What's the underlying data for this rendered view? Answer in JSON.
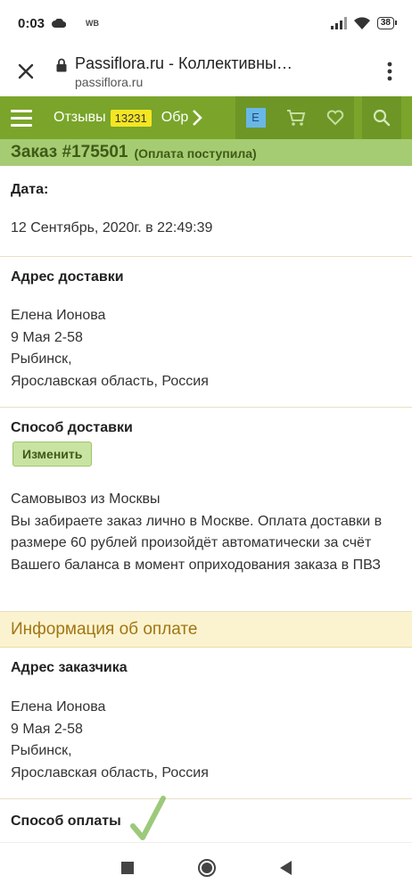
{
  "status_bar": {
    "time": "0:03",
    "carrier": "WB",
    "battery": "38",
    "icons": [
      "cloud-icon",
      "signal-icon",
      "wifi-icon",
      "battery-icon"
    ]
  },
  "browser": {
    "title": "Passiflora.ru - Коллективны…",
    "url": "passiflora.ru",
    "icons": [
      "close-icon",
      "lock-icon",
      "more-vert-icon"
    ]
  },
  "site_nav": {
    "reviews_label": "Отзывы",
    "reviews_count": "13231",
    "next_label": "Обр",
    "avatar_letter": "E",
    "icons": [
      "menu-icon",
      "chevron-right-icon",
      "cart-icon",
      "heart-icon",
      "search-icon"
    ]
  },
  "order": {
    "number": "Заказ #175501",
    "status": "(Оплата поступила)"
  },
  "date_section": {
    "label": "Дата:",
    "value": "12 Сентябрь, 2020г. в 22:49:39"
  },
  "delivery_address": {
    "label": "Адрес доставки",
    "name": "Елена Ионова",
    "street": "9 Мая 2-58",
    "city": "Рыбинск,",
    "region": "Ярославская область, Россия"
  },
  "delivery_method": {
    "label": "Способ доставки",
    "change_button": "Изменить",
    "method": "Самовывоз из Москвы",
    "description": "Вы забираете заказ лично в Москве. Оплата доставки в размере 60 рублей произойдёт автоматически за счёт Вашего баланса в момент оприходования заказа в ПВЗ"
  },
  "payment_info": {
    "heading": "Информация об оплате"
  },
  "customer_address": {
    "label": "Адрес заказчика",
    "name": "Елена Ионова",
    "street": "9 Мая 2-58",
    "city": "Рыбинск,",
    "region": "Ярославская область, Россия"
  },
  "payment_method": {
    "label": "Способ оплаты"
  },
  "colors": {
    "nav_green": "#7aa52a",
    "header_green": "#a5cc72",
    "badge_yellow": "#f5e623",
    "info_bg": "#fbf3d0",
    "info_text": "#a17613"
  }
}
